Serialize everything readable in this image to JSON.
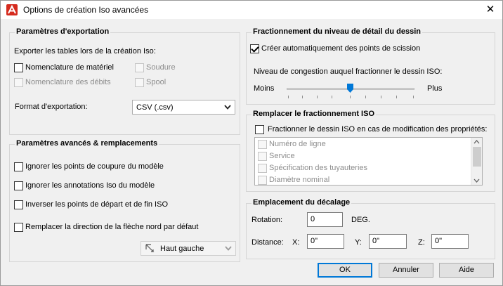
{
  "window": {
    "title": "Options de création Iso avancées",
    "close": "✕"
  },
  "export": {
    "title": "Paramètres d'exportation",
    "tables_label": "Exporter les tables lors de la création Iso:",
    "bom": "Nomenclature de matériel",
    "weld": "Soudure",
    "cutlist": "Nomenclature des débits",
    "spool": "Spool",
    "format_label": "Format d'exportation:",
    "format_value": "CSV (.csv)"
  },
  "advanced": {
    "title": "Paramètres avancés & remplacements",
    "ignore_breaks": "Ignorer les points de coupure du modèle",
    "ignore_annotations": "Ignorer les annotations Iso du modèle",
    "reverse": "Inverser les points de départ et de fin ISO",
    "override_north": "Remplacer la direction de la flèche nord par défaut",
    "north_value": "Haut gauche"
  },
  "split": {
    "title": "Fractionnement du niveau de détail du dessin",
    "auto": "Créer automatiquement des points de scission",
    "auto_checked": true,
    "congestion_label": "Niveau de congestion auquel fractionner le dessin ISO:",
    "less": "Moins",
    "more": "Plus",
    "slider_value": 0.38
  },
  "override_split": {
    "title": "Remplacer le fractionnement ISO",
    "on_change": "Fractionner le dessin ISO en cas de modification des propriétés:",
    "items": [
      "Numéro de ligne",
      "Service",
      "Spécification des tuyauteries",
      "Diamètre nominal"
    ]
  },
  "offset": {
    "title": "Emplacement du décalage",
    "rotation_label": "Rotation:",
    "rotation_value": "0",
    "rotation_unit": "DEG.",
    "distance_label": "Distance:",
    "x_label": "X:",
    "x_value": "0\"",
    "y_label": "Y:",
    "y_value": "0\"",
    "z_label": "Z:",
    "z_value": "0\""
  },
  "buttons": {
    "ok": "OK",
    "cancel": "Annuler",
    "help": "Aide"
  },
  "colors": {
    "accent": "#0078d7",
    "autocad_red": "#d52b1e"
  },
  "icons": [
    "autocad-logo-icon",
    "close-icon",
    "chevron-down-icon",
    "north-arrow-icon",
    "slider-thumb-icon"
  ]
}
